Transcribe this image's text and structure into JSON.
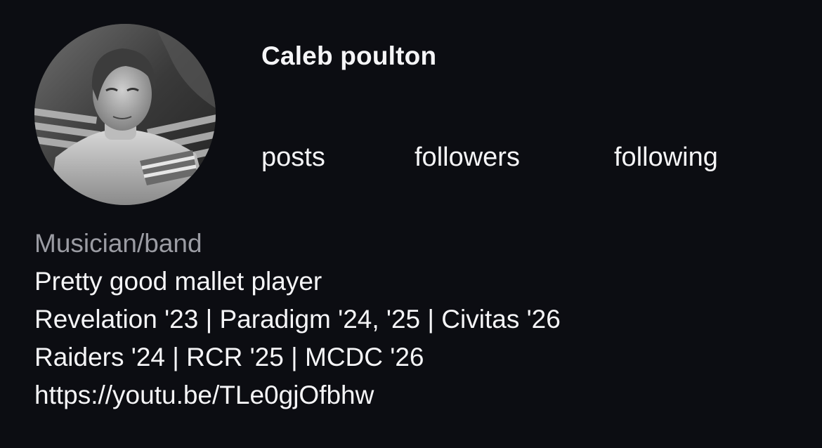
{
  "profile": {
    "name": "Caleb poulton",
    "avatar_icon": "profile-photo",
    "stats": {
      "posts_label": "posts",
      "followers_label": "followers",
      "following_label": "following"
    },
    "bio": {
      "category": "Musician/band",
      "lines": [
        "Pretty good mallet player",
        "Revelation '23 | Paradigm '24, '25 | Civitas '26",
        "Raiders '24 | RCR '25 | MCDC '26"
      ],
      "link": "https://youtu.be/TLe0gjOfbhw"
    }
  },
  "colors": {
    "background": "#0c0d12",
    "text": "#f5f5f7",
    "category": "#9b9ca3"
  }
}
